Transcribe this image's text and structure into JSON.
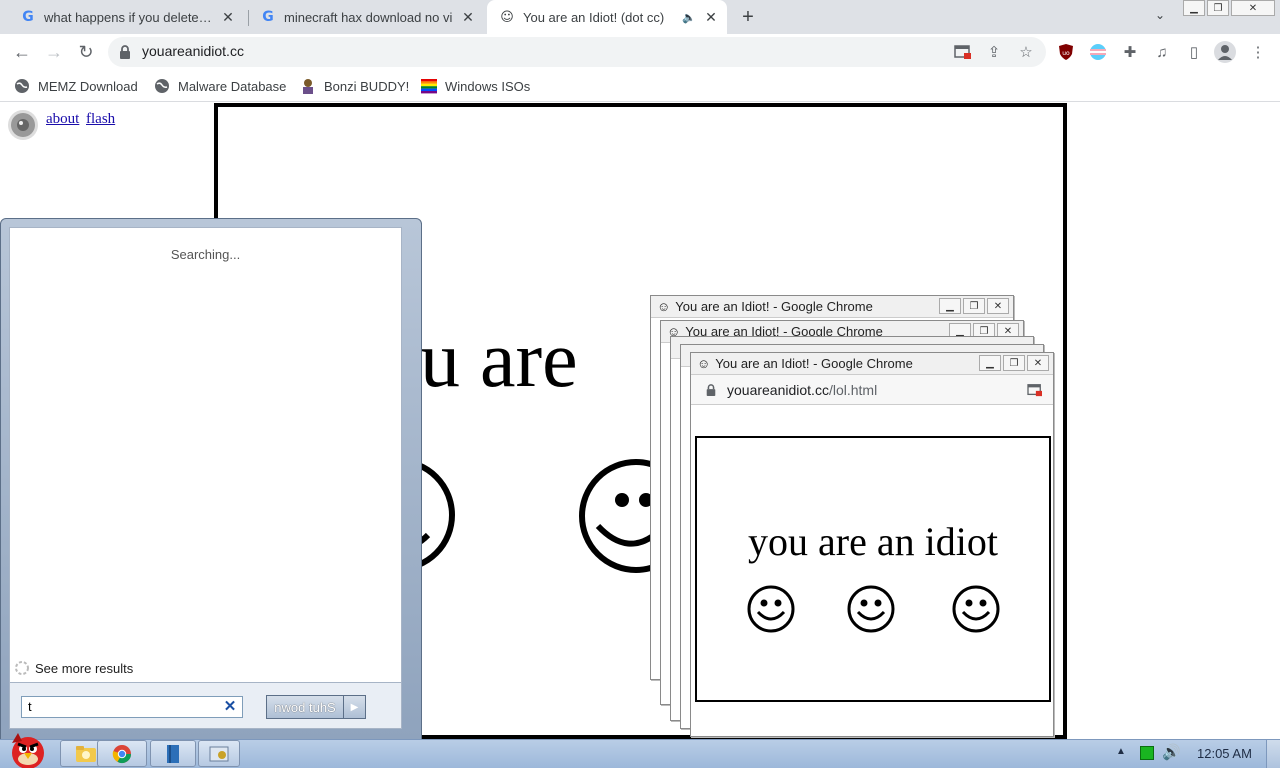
{
  "tabs": [
    {
      "title": "what happens if you delete sy"
    },
    {
      "title": "minecraft hax download no vi"
    },
    {
      "title": "You are an Idiot! (dot cc)"
    }
  ],
  "address_bar": {
    "url": "youareanidiot.cc"
  },
  "bookmarks": [
    {
      "label": "MEMZ Download"
    },
    {
      "label": "Malware Database"
    },
    {
      "label": "Bonzi BUDDY!"
    },
    {
      "label": "Windows ISOs"
    }
  ],
  "page": {
    "links": {
      "about": "about",
      "flash": "flash"
    },
    "headline_fragment": "ou are"
  },
  "popups": {
    "window_title": "You are an Idiot! - Google Chrome",
    "url_domain": "youareanidiot.cc",
    "url_path": "/lol.html",
    "headline": "you are an idiot"
  },
  "start_menu": {
    "status": "Searching...",
    "see_more": "See more results",
    "search_value": "t",
    "shutdown_label": "nwod tuhS"
  },
  "taskbar": {
    "clock": "12:05 AM"
  },
  "colors": {
    "accent": "#1a73e8",
    "taskbar": "#9db8da",
    "link": "#1a0dab"
  }
}
